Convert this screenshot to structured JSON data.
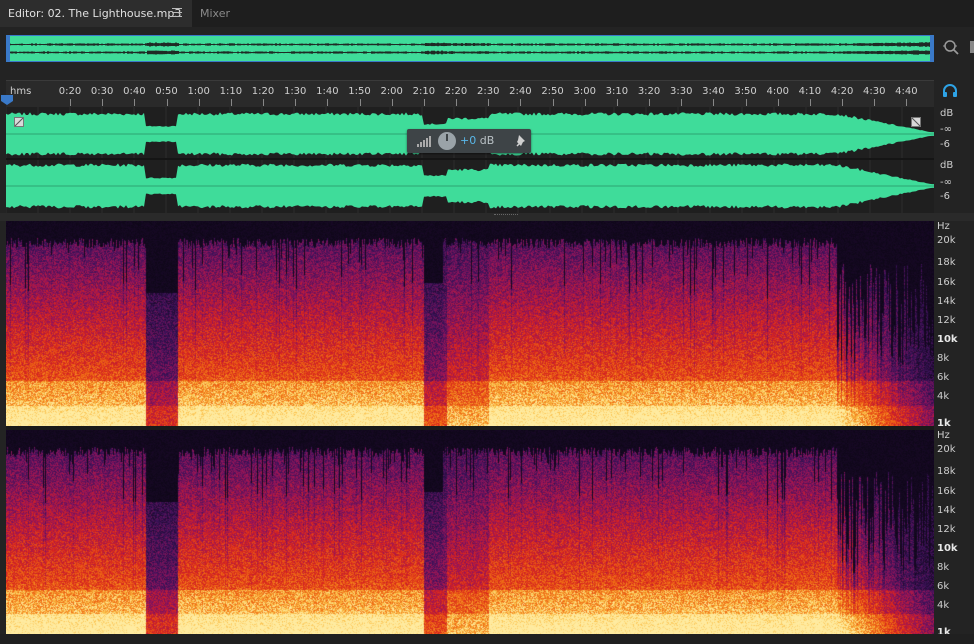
{
  "tabs": {
    "editor_label": "Editor: 02. The Lighthouse.mp3",
    "mixer_label": "Mixer"
  },
  "ruler": {
    "unit": "hms",
    "ticks": [
      "0:20",
      "0:30",
      "0:40",
      "0:50",
      "1:00",
      "1:10",
      "1:20",
      "1:30",
      "1:40",
      "1:50",
      "2:00",
      "2:10",
      "2:20",
      "2:30",
      "2:40",
      "2:50",
      "3:00",
      "3:10",
      "3:20",
      "3:30",
      "3:40",
      "3:50",
      "4:00",
      "4:10",
      "4:20",
      "4:30",
      "4:40"
    ]
  },
  "hud": {
    "value": "+0",
    "unit": "dB"
  },
  "db_scale": {
    "unit": "dB",
    "neg_inf": "-∞",
    "minus6": "-6"
  },
  "spectral_scale": {
    "unit": "Hz",
    "labels": [
      "20k",
      "18k",
      "16k",
      "14k",
      "12k",
      "10k",
      "8k",
      "6k",
      "4k",
      "1k"
    ]
  },
  "colors": {
    "waveform": "#3fdc9a",
    "accent": "#3a79c8",
    "hud_value": "#59b7e8"
  },
  "icons": {
    "tab_menu": "hamburger-icon",
    "zoom": "zoom-magnifier-icon",
    "monitor": "headphones-icon",
    "pin": "pin-icon",
    "meter": "level-meter-icon",
    "knob": "gain-knob-icon"
  }
}
